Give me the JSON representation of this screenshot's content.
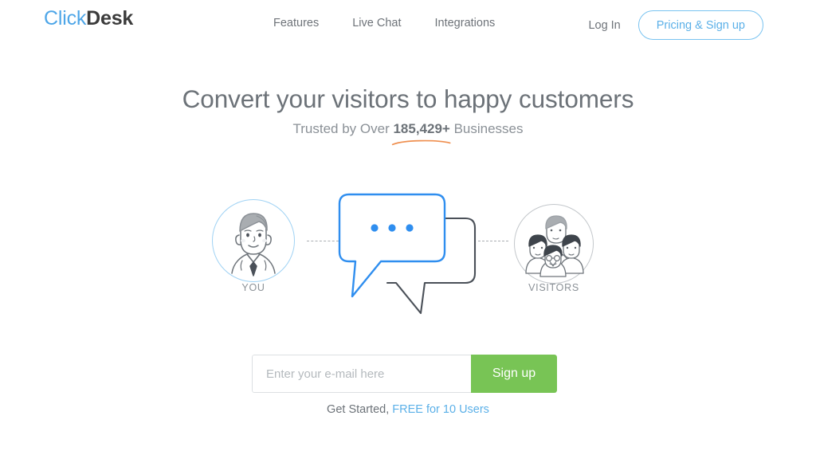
{
  "brand": {
    "logo_primary": "Click",
    "logo_secondary": "Desk",
    "accent_blue": "#5bb0e8",
    "bubble_blue": "#2f8eef",
    "accent_green": "#78c455",
    "accent_orange": "#ef8f4f",
    "text_gray": "#6c7278"
  },
  "header": {
    "nav": [
      {
        "label": "Features"
      },
      {
        "label": "Live Chat"
      },
      {
        "label": "Integrations"
      }
    ],
    "login_label": "Log In",
    "pricing_label": "Pricing & Sign up"
  },
  "hero": {
    "headline": "Convert your visitors to happy customers",
    "subhead_prefix": "Trusted by Over ",
    "subhead_count": "185,429+",
    "subhead_suffix": " Businesses"
  },
  "illustration": {
    "left_caption": "YOU",
    "right_caption": "VISITORS",
    "left_icon": "businessman-avatar-icon",
    "right_icon": "group-of-visitors-avatar-icon",
    "bubble_front_icon": "blue-chat-bubble-with-typing-dots-icon",
    "bubble_back_icon": "gray-chat-bubble-icon",
    "typing_dots": 3
  },
  "signup": {
    "email_placeholder": "Enter your e-mail here",
    "email_value": "",
    "button_label": "Sign up",
    "footnote_prefix": "Get Started, ",
    "footnote_link": "FREE for 10 Users"
  }
}
